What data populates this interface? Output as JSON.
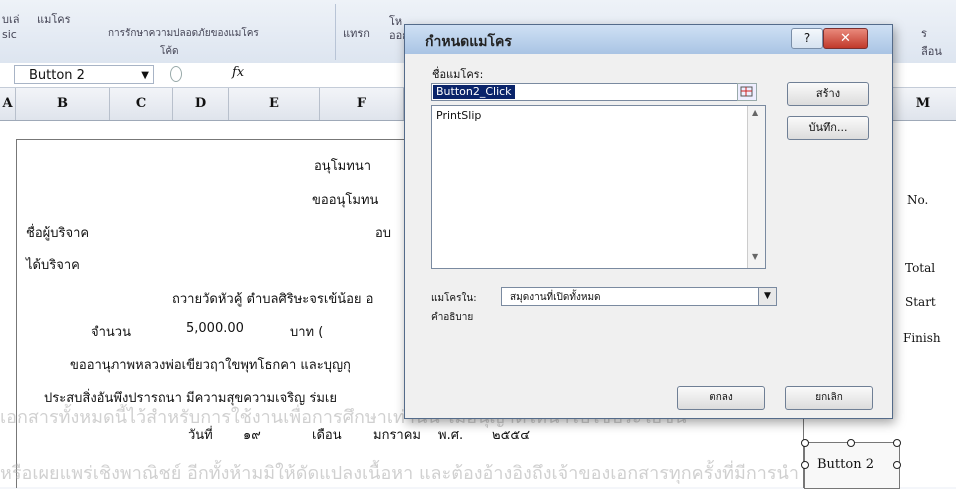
{
  "ribbon": {
    "item1_lines": [
      "บเล่",
      "sic"
    ],
    "macros_label": "แมโคร",
    "macro_security": "การรักษาความปลอดภัยของแมโคร",
    "code_group": "โค้ด",
    "insert": "แทรก",
    "mode_partial": "โห",
    "design_partial": "ออก",
    "right_partial": [
      "ร",
      "ลือน"
    ]
  },
  "formula_bar": {
    "name_box": "Button 2",
    "fx": "fx"
  },
  "columns": [
    "A",
    "B",
    "C",
    "D",
    "E",
    "F",
    "M"
  ],
  "sheet": {
    "line1": "อนุโมทนา",
    "line2": "ขออนุโมทน",
    "donor_label": "ชื่อผู้บริจาค",
    "donor_right": "อบ",
    "donated_label": "ได้บริจาค",
    "offer_line": "ถวายวัดหัวคู้ ตำบลศิริษะจรเข้น้อย อ",
    "amount_label": "จำนวน",
    "amount_value": "5,000.00",
    "baht": "บาท (",
    "blessing_line": "ขออานุภาพหลวงพ่อเขียวฤาใขพุทโธกคา และบุญกุ",
    "wish_line": "ประสบสิ่งอันพึงปรารถนา มีความสุขความเจริญ ร่มเย",
    "date_day_label": "วันที่",
    "date_day": "๑๙",
    "date_month_label": "เดือน",
    "date_month": "มกราคม",
    "date_era": "พ.ศ.",
    "date_year": "๒๕๕๔",
    "col_m": {
      "no": "No.",
      "total": "Total",
      "start": "Start",
      "finish": "Finish"
    },
    "button_label": "Button 2"
  },
  "watermark": {
    "line1": "เอกสารทั้งหมดนี้ไว้สำหรับการใช้งานเพื่อการศึกษาเท่านั้น ไม่อนุญาตให้นำไปใช้ประโยชน์",
    "line2": "หรือเผยแพร่เชิงพาณิชย์ อีกทั้งห้ามมิให้ดัดแปลงเนื้อหา และต้องอ้างอิงถึงเจ้าของเอกสารทุกครั้งที่มีการนำ"
  },
  "dialog": {
    "title": "กำหนดแมโคร",
    "help": "?",
    "close": "✕",
    "macro_name_label": "ชื่อแมโคร:",
    "macro_name_value": "Button2_Click",
    "macro_list": [
      "PrintSlip"
    ],
    "new_button": "สร้าง",
    "record_button": "บันทึก...",
    "macros_in_label": "แมโครใน:",
    "macros_in_value": "สมุดงานที่เปิดทั้งหมด",
    "description_label": "คำอธิบาย",
    "ok_button": "ตกลง",
    "cancel_button": "ยกเลิก"
  },
  "icons": {
    "fx": "fx-icon",
    "pick": "cell-pick-icon",
    "dropdown": "chevron-down-icon"
  },
  "colors": {
    "title_bar": "#a9c4e4",
    "close_button": "#c1392b",
    "selection": "#0a246a"
  }
}
